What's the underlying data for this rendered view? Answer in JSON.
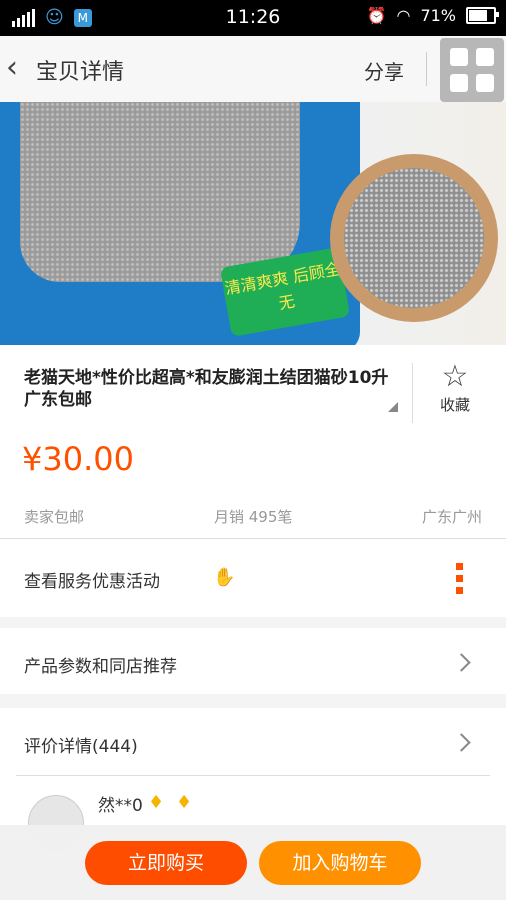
{
  "status_bar": {
    "time": "11:26",
    "battery": "71%"
  },
  "nav": {
    "title": "宝贝详情",
    "share": "分享"
  },
  "product": {
    "title": "老猫天地*性价比超高*和友膨润土结团猫砂10升 广东包邮",
    "favorite_label": "收藏",
    "price": "¥30.00",
    "shipping": "卖家包邮",
    "monthly_sales": "月销 495笔",
    "location": "广东广州",
    "bag_text": "清清爽爽 后顾全无"
  },
  "rows": {
    "service": "查看服务优惠活动",
    "params": "产品参数和同店推荐",
    "reviews": "评价详情(444)"
  },
  "review": {
    "user": "然**0"
  },
  "actions": {
    "buy": "立即购买",
    "cart": "加入购物车"
  }
}
